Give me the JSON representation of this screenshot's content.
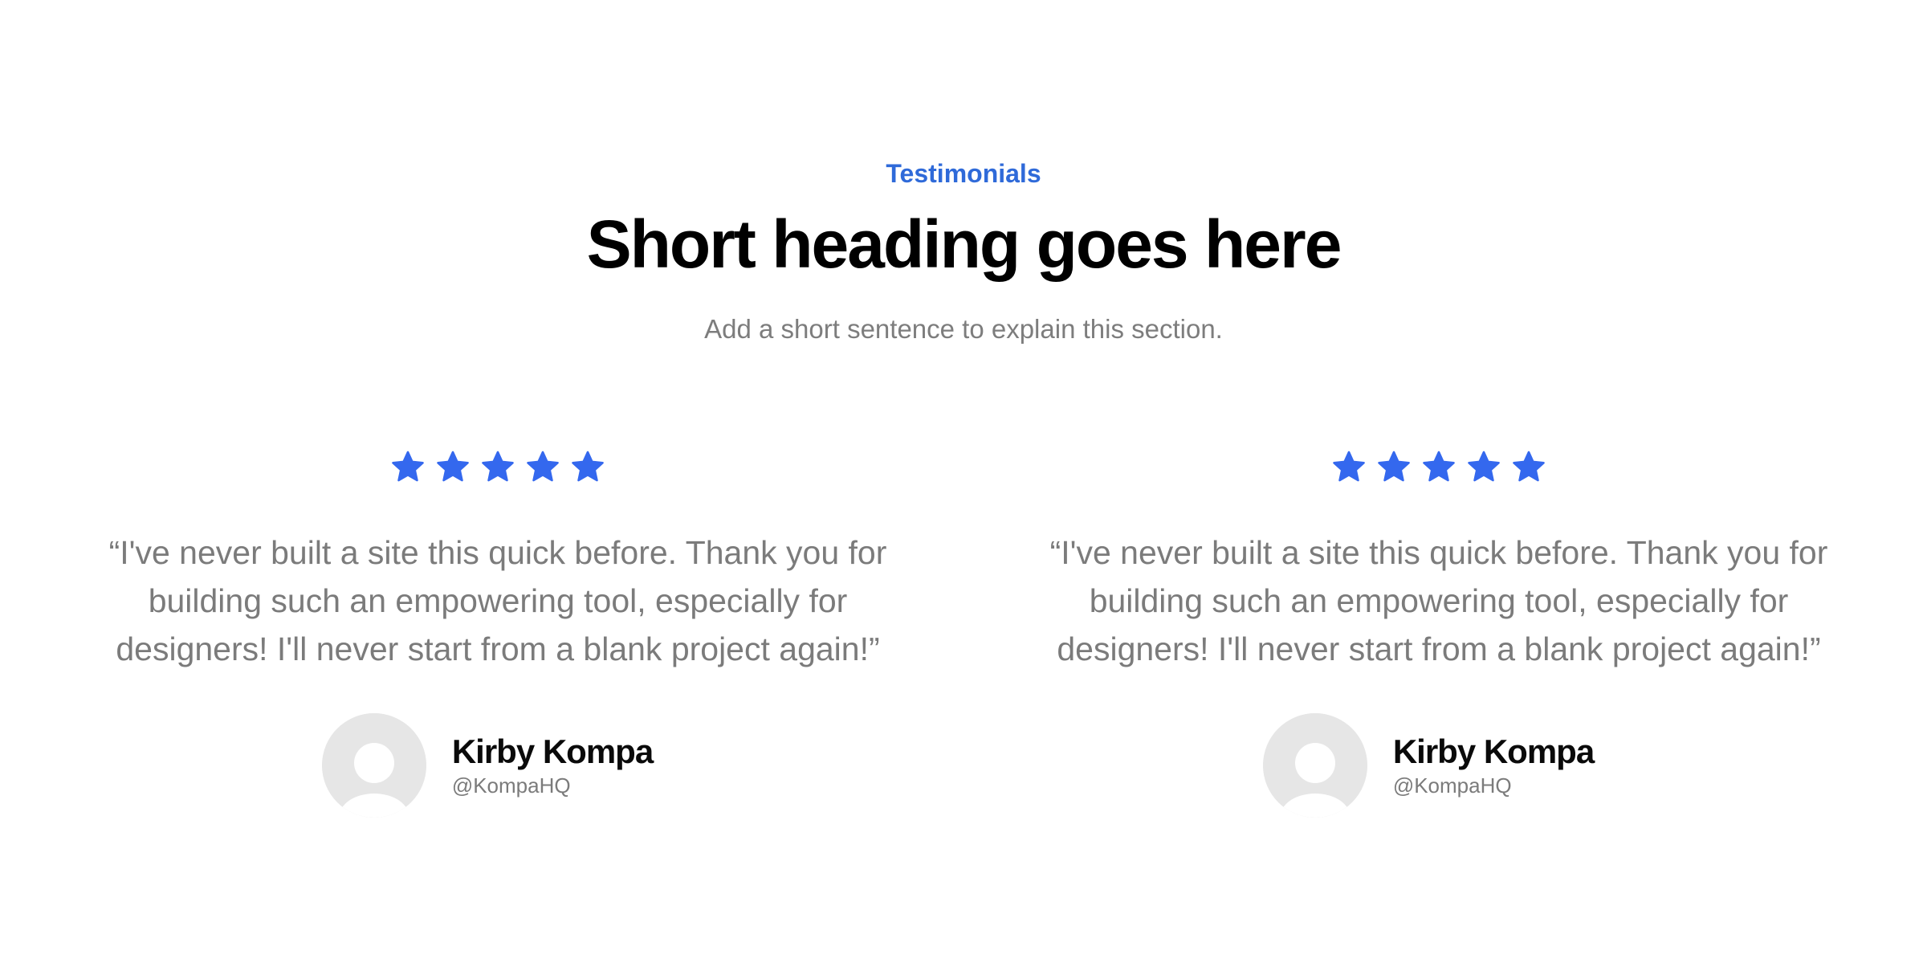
{
  "section": {
    "eyebrow": "Testimonials",
    "title": "Short heading goes here",
    "subtitle": "Add a short sentence to explain this section."
  },
  "colors": {
    "accent": "#2f6ad9",
    "star": "#3468ee",
    "heading": "#000000",
    "muted_text": "#7b7b7b",
    "avatar_bg": "#e6e6e6",
    "avatar_fg": "#ffffff"
  },
  "testimonials": [
    {
      "rating": 5,
      "quote": "“I've never built a site this quick before. Thank you for building such an empowering tool, especially for designers! I'll never start from a blank project again!”",
      "author_name": "Kirby Kompa",
      "author_handle": "@KompaHQ",
      "avatar_icon": "user-avatar-placeholder-icon"
    },
    {
      "rating": 5,
      "quote": "“I've never built a site this quick before. Thank you for building such an empowering tool, especially for designers! I'll never start from a blank project again!”",
      "author_name": "Kirby Kompa",
      "author_handle": "@KompaHQ",
      "avatar_icon": "user-avatar-placeholder-icon"
    }
  ]
}
